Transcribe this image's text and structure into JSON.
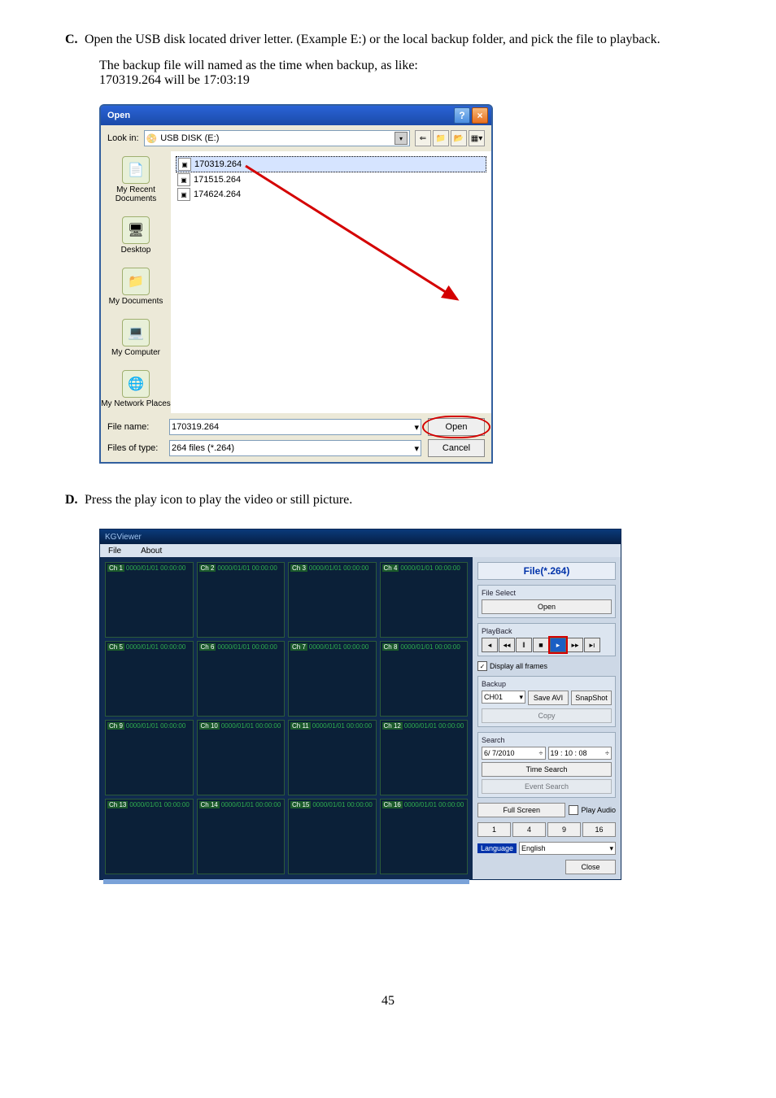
{
  "sectionC": {
    "marker": "C.",
    "text": "Open the USB disk located driver letter. (Example E:) or the local backup folder, and pick the file to playback.",
    "note1": "The backup file will named as the time when backup, as like:",
    "note2": "170319.264 will be 17:03:19"
  },
  "dialog": {
    "title": "Open",
    "lookin_label": "Look in:",
    "lookin_value": "USB DISK (E:)",
    "files": [
      "170319.264",
      "171515.264",
      "174624.264"
    ],
    "places": [
      "My Recent Documents",
      "Desktop",
      "My Documents",
      "My Computer",
      "My Network Places"
    ],
    "filename_label": "File name:",
    "filename_value": "170319.264",
    "filetype_label": "Files of type:",
    "filetype_value": "264 files (*.264)",
    "open": "Open",
    "cancel": "Cancel"
  },
  "sectionD": {
    "marker": "D.",
    "text": "Press the play icon to play the video or still picture."
  },
  "app": {
    "title": "KGViewer",
    "menu": [
      "File",
      "About"
    ],
    "cell_ts": "0000/01/01 00:00:00",
    "ch_labels": [
      "Ch 1",
      "Ch 2",
      "Ch 3",
      "Ch 4",
      "Ch 5",
      "Ch 6",
      "Ch 7",
      "Ch 8",
      "Ch 9",
      "Ch 10",
      "Ch 11",
      "Ch 12",
      "Ch 13",
      "Ch 14",
      "Ch 15",
      "Ch 16"
    ],
    "side": {
      "file_label": "File(*.264)",
      "fileselect": "File Select",
      "open": "Open",
      "playback": "PlayBack",
      "display_all": "Display all frames",
      "backup": "Backup",
      "ch_sel": "CH01",
      "save_avi": "Save AVI",
      "snapshot": "SnapShot",
      "copy": "Copy",
      "search": "Search",
      "date": "6/ 7/2010",
      "time": "19 : 10 : 08",
      "time_search": "Time Search",
      "event_search": "Event Search",
      "full_screen": "Full Screen",
      "play_audio": "Play Audio",
      "grid": [
        "1",
        "4",
        "9",
        "16"
      ],
      "language_label": "Language",
      "language_value": "English",
      "close": "Close"
    }
  },
  "page_number": "45"
}
